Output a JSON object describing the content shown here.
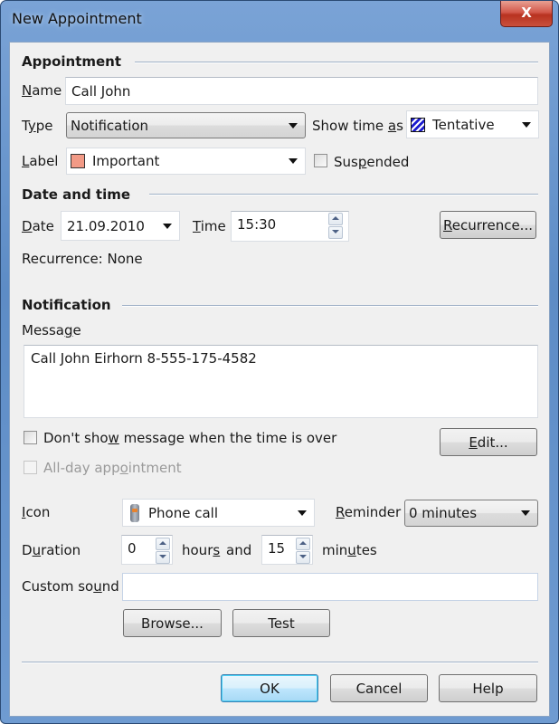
{
  "window": {
    "title": "New Appointment",
    "close_label": "X"
  },
  "appointment": {
    "section_title": "Appointment",
    "name_label_u": "N",
    "name_label_rest": "ame",
    "name_value": "Call John",
    "type_label_pre": "T",
    "type_label_u": "y",
    "type_label_rest": "pe",
    "type_value": "Notification",
    "show_time_as_label_pre": "Show time ",
    "show_time_as_label_u": "a",
    "show_time_as_label_rest": "s",
    "show_time_as_value": "Tentative",
    "show_time_as_color": "#1c1ccf",
    "label_label_u": "L",
    "label_label_rest": "abel",
    "label_value": "Important",
    "label_color": "#f29a86",
    "suspended_label_pre": "Sus",
    "suspended_label_u": "p",
    "suspended_label_rest": "ended",
    "suspended_checked": false
  },
  "date_time": {
    "section_title": "Date and time",
    "date_label_u": "D",
    "date_label_rest": "ate",
    "date_value": "21.09.2010",
    "time_label_u": "T",
    "time_label_rest": "ime",
    "time_value": "15:30",
    "recurrence_button_u": "R",
    "recurrence_button_rest": "ecurrence...",
    "recurrence_status": "Recurrence: None"
  },
  "notification": {
    "section_title": "Notification",
    "message_label_pre": "Messa",
    "message_label_u": "g",
    "message_label_rest": "e",
    "message_value": "Call John Eirhorn 8-555-175-4582",
    "dont_show_label_pre": "Don't sho",
    "dont_show_label_u": "w",
    "dont_show_label_rest": " message when the time is over",
    "dont_show_checked": false,
    "edit_button_u": "E",
    "edit_button_rest": "dit...",
    "all_day_label_pre": "All-day app",
    "all_day_label_u": "o",
    "all_day_label_rest": "intment",
    "all_day_checked": false,
    "icon_label_u": "I",
    "icon_label_rest": "con",
    "icon_value": "Phone call",
    "reminder_label_u": "R",
    "reminder_label_rest": "eminder",
    "reminder_value": "0 minutes",
    "duration_label_pre": "D",
    "duration_label_u": "u",
    "duration_label_rest": "ration",
    "duration_hours": "0",
    "hours_label_pre": "hour",
    "hours_label_u": "s",
    "hours_label_rest": "",
    "and_label": "and",
    "duration_minutes": "15",
    "minutes_label_pre": "min",
    "minutes_label_u": "u",
    "minutes_label_rest": "tes",
    "custom_sound_label_pre": "Custom so",
    "custom_sound_label_u": "u",
    "custom_sound_label_rest": "nd",
    "custom_sound_value": "",
    "browse_button": "Browse...",
    "test_button": "Test"
  },
  "footer": {
    "ok_button": "OK",
    "cancel_button": "Cancel",
    "help_button": "Help"
  }
}
